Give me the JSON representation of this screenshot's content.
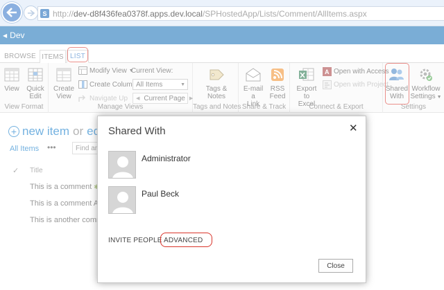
{
  "browser": {
    "url_protocol": "http://",
    "url_host": "dev-d8f436fea0378f.apps.dev.local",
    "url_path": "/SPHostedApp/Lists/Comment/AllItems.aspx"
  },
  "suite": {
    "site_name": "Dev"
  },
  "ribbon_tabs": {
    "browse": "BROWSE",
    "items": "ITEMS",
    "list": "LIST"
  },
  "ribbon": {
    "view_format": {
      "label": "View Format",
      "view": "View",
      "quick_edit_1": "Quick",
      "quick_edit_2": "Edit"
    },
    "manage_views": {
      "label": "Manage Views",
      "create_view_1": "Create",
      "create_view_2": "View",
      "modify_view": "Modify View",
      "create_column": "Create Column",
      "navigate_up": "Navigate Up",
      "current_view_label": "Current View:",
      "current_view_value": "All Items",
      "current_page": "Current Page"
    },
    "tags_notes": {
      "label": "Tags and Notes",
      "btn_1": "Tags &",
      "btn_2": "Notes"
    },
    "share_track": {
      "label": "Share & Track",
      "email_1": "E-mail a",
      "email_2": "Link",
      "rss_1": "RSS",
      "rss_2": "Feed"
    },
    "connect_export": {
      "label": "Connect & Export",
      "export_1": "Export to",
      "export_2": "Excel",
      "open_access": "Open with Access",
      "open_project": "Open with Project"
    },
    "settings": {
      "label": "Settings",
      "shared_with_1": "Shared",
      "shared_with_2": "With",
      "workflow_1": "Workflow",
      "workflow_2": "Settings"
    }
  },
  "content": {
    "new_item": "new item",
    "or": "or",
    "edit": "edit",
    "view_name": "All Items",
    "ellipsis": "•••",
    "find_placeholder": "Find an",
    "col_title": "Title",
    "rows": [
      "This is a comment",
      "This is a comment Aw",
      "This is another comm"
    ]
  },
  "dialog": {
    "title": "Shared With",
    "people": [
      "Administrator",
      "Paul Beck"
    ],
    "invite": "INVITE PEOPLE",
    "advanced": "ADVANCED",
    "close": "Close"
  },
  "colors": {
    "sp_blue": "#0072c6",
    "suite_bar": "#0d6ab4",
    "highlight_red": "#d9342b"
  }
}
